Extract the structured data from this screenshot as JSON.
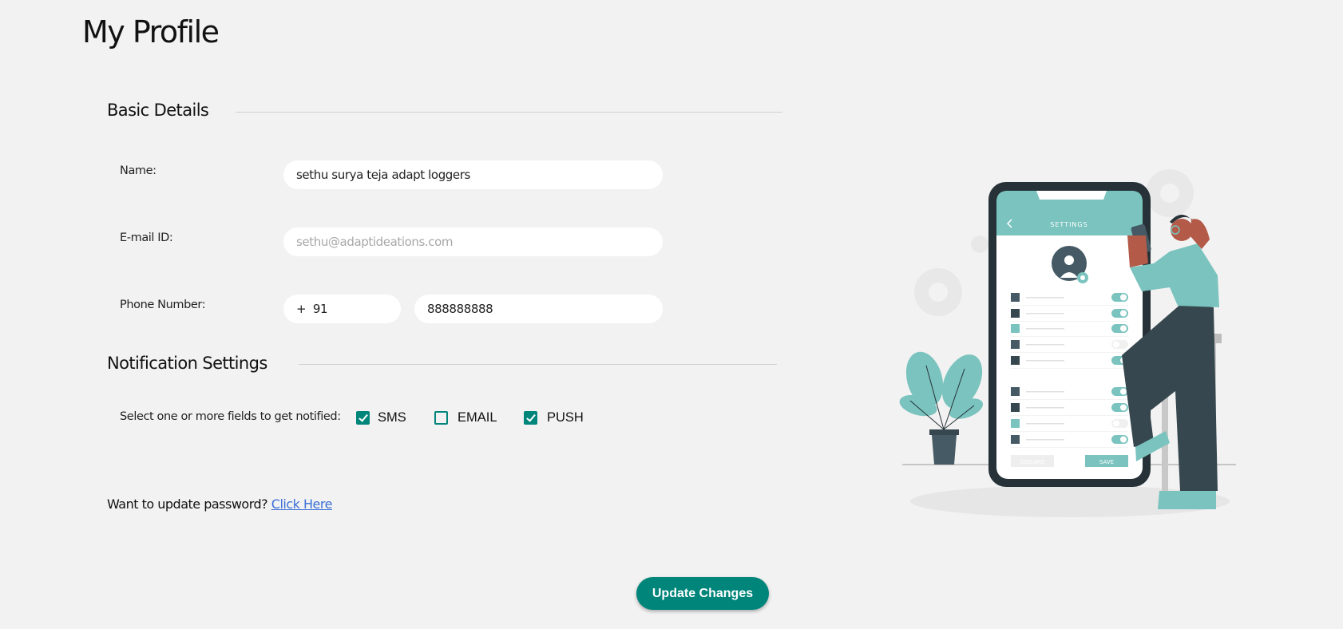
{
  "page": {
    "title": "My Profile"
  },
  "basic": {
    "heading": "Basic Details",
    "name_label": "Name:",
    "name_value": "sethu surya teja adapt loggers",
    "email_label": "E-mail ID:",
    "email_placeholder": "sethu@adaptideations.com",
    "phone_label": "Phone Number:",
    "phone_code": "+  91",
    "phone_number": "888888888"
  },
  "notifications": {
    "heading": "Notification Settings",
    "prompt": "Select one or more fields to get notified:",
    "options": [
      {
        "label": "SMS",
        "checked": true
      },
      {
        "label": "EMAIL",
        "checked": false
      },
      {
        "label": "PUSH",
        "checked": true
      }
    ]
  },
  "password": {
    "prompt": "Want to update password?",
    "link": "Click Here"
  },
  "actions": {
    "update": "Update Changes"
  },
  "illustration": {
    "screen_title": "SETTINGS",
    "discard": "DISCARD",
    "save": "SAVE"
  },
  "colors": {
    "accent": "#00857a",
    "illustration_teal": "#7ac3be",
    "illustration_dark": "#263238",
    "link": "#3b6fd6"
  }
}
